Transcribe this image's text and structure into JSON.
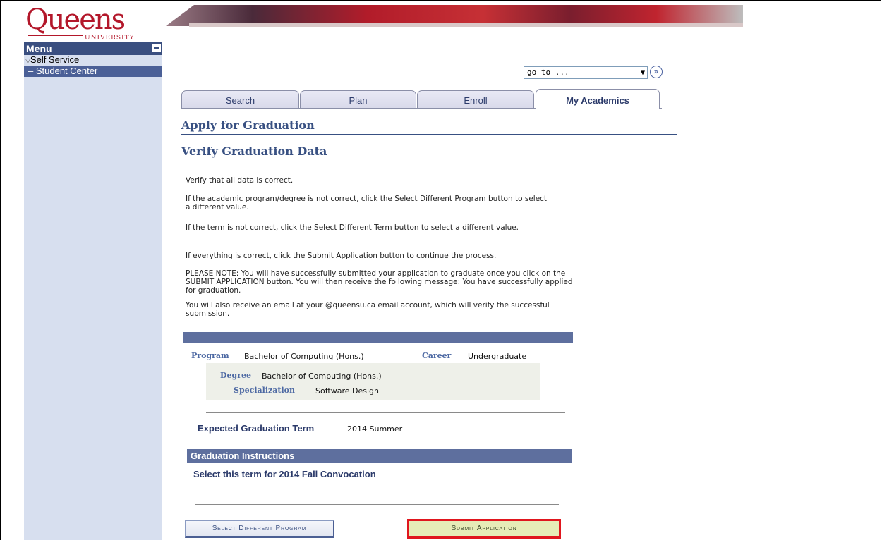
{
  "logo": {
    "word": "Queens",
    "sub": "UNIVERSITY"
  },
  "menu": {
    "title": "Menu",
    "section": "Self Service",
    "active_item": "Student Center"
  },
  "goto": {
    "value": "go to ...",
    "button": "»"
  },
  "tabs": [
    "Search",
    "Plan",
    "Enroll",
    "My Academics"
  ],
  "page": {
    "title": "Apply for Graduation",
    "subtitle": "Verify Graduation Data",
    "paragraphs": [
      "Verify that all data is correct.",
      "If the academic program/degree is not correct, click the Select Different Program button to select a different value.",
      "If the term is not correct, click the Select Different Term button to select a different value.",
      "If everything is correct, click the Submit Application button to continue the process.",
      "PLEASE NOTE: You will have successfully submitted your application to graduate once you click on the SUBMIT APPLICATION button. You will then receive the following message: You have successfully applied for graduation.",
      "You will also receive an email at your @queensu.ca email account, which will verify the successful submission."
    ]
  },
  "program": {
    "program_label": "Program",
    "program_value": "Bachelor of Computing (Hons.)",
    "career_label": "Career",
    "career_value": "Undergraduate",
    "degree_label": "Degree",
    "degree_value": "Bachelor of Computing (Hons.)",
    "spec_label": "Specialization",
    "spec_value": "Software Design"
  },
  "term": {
    "label": "Expected Graduation Term",
    "value": "2014 Summer"
  },
  "instructions": {
    "header": "Graduation Instructions",
    "text": "Select this term for 2014 Fall Convocation"
  },
  "buttons": {
    "select_program": "Select Different Program",
    "submit": "Submit Application"
  },
  "colors": {
    "accent": "#385082",
    "bar": "#5e6f9e",
    "highlight": "#e0161e"
  }
}
